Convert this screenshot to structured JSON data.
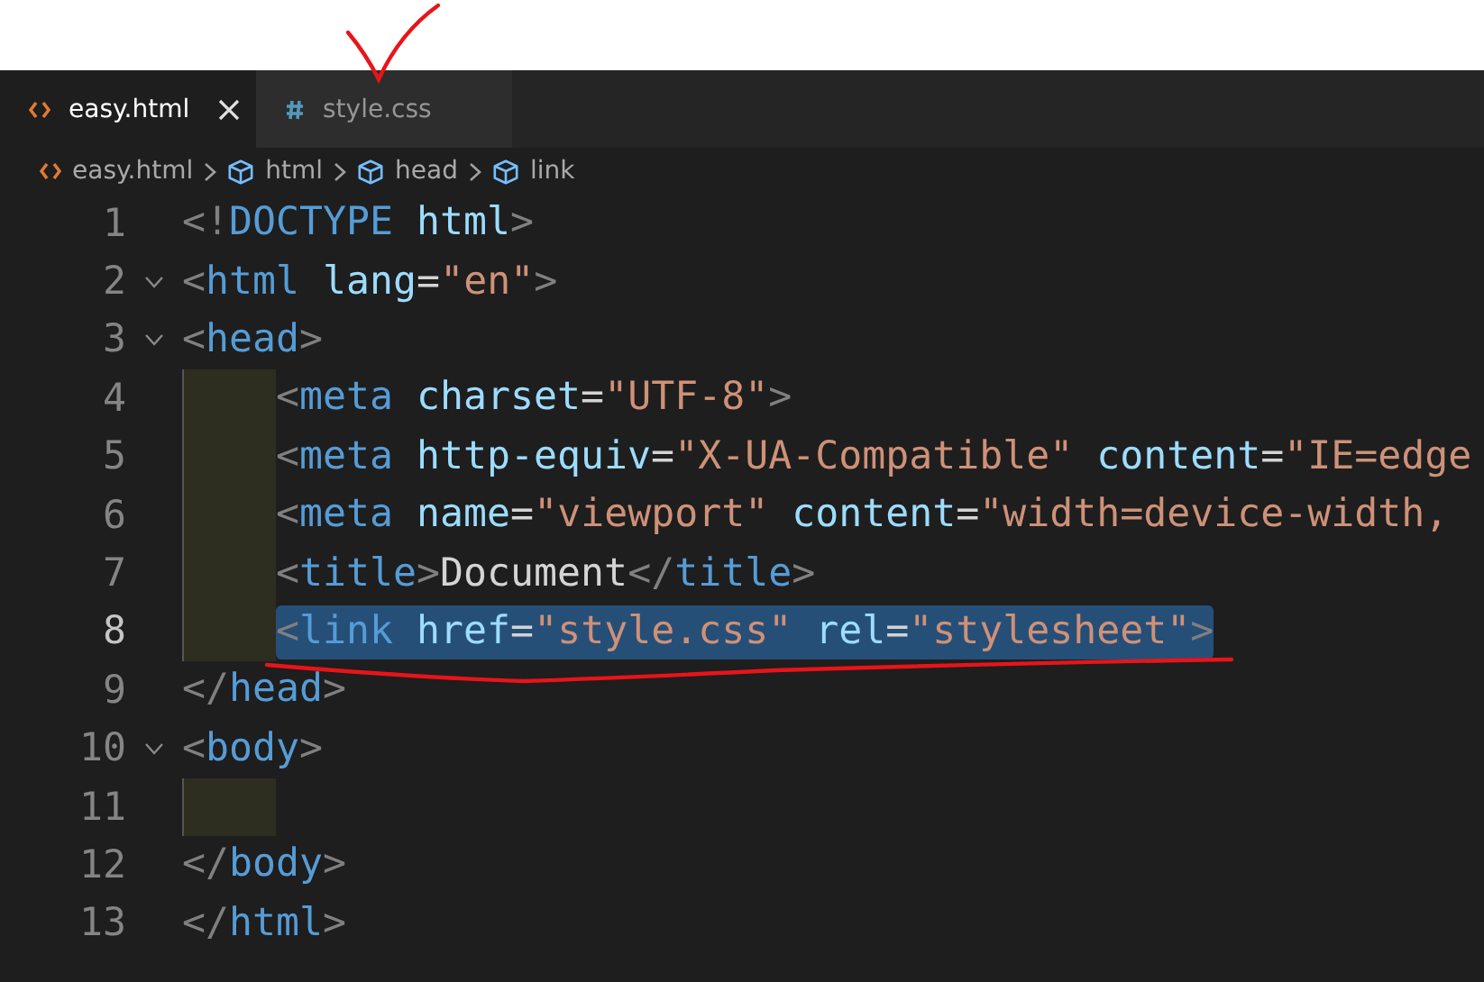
{
  "tabs": [
    {
      "label": "easy.html",
      "kind": "html",
      "selected": true
    },
    {
      "label": "style.css",
      "kind": "css",
      "selected": false
    }
  ],
  "breadcrumbs": [
    {
      "label": "easy.html",
      "kind": "file"
    },
    {
      "label": "html",
      "kind": "element"
    },
    {
      "label": "head",
      "kind": "element"
    },
    {
      "label": "link",
      "kind": "element"
    }
  ],
  "lines": [
    {
      "number": "1",
      "fold": false,
      "indented": false,
      "selected": false,
      "tokens": [
        {
          "kind": "punct",
          "text": "<!"
        },
        {
          "kind": "tag",
          "text": "DOCTYPE"
        },
        {
          "kind": "attr",
          "text": " html"
        },
        {
          "kind": "punct",
          "text": ">"
        }
      ]
    },
    {
      "number": "2",
      "fold": true,
      "indented": false,
      "selected": false,
      "tokens": [
        {
          "kind": "punct",
          "text": "<"
        },
        {
          "kind": "tag",
          "text": "html"
        },
        {
          "kind": "attr",
          "text": " lang"
        },
        {
          "kind": "text",
          "text": "="
        },
        {
          "kind": "str",
          "text": "\"en\""
        },
        {
          "kind": "punct",
          "text": ">"
        }
      ]
    },
    {
      "number": "3",
      "fold": true,
      "indented": false,
      "selected": false,
      "tokens": [
        {
          "kind": "punct",
          "text": "<"
        },
        {
          "kind": "tag",
          "text": "head"
        },
        {
          "kind": "punct",
          "text": ">"
        }
      ]
    },
    {
      "number": "4",
      "fold": false,
      "indented": true,
      "selected": false,
      "tokens": [
        {
          "kind": "punct",
          "text": "<"
        },
        {
          "kind": "tag",
          "text": "meta"
        },
        {
          "kind": "attr",
          "text": " charset"
        },
        {
          "kind": "text",
          "text": "="
        },
        {
          "kind": "str",
          "text": "\"UTF-8\""
        },
        {
          "kind": "punct",
          "text": ">"
        }
      ]
    },
    {
      "number": "5",
      "fold": false,
      "indented": true,
      "selected": false,
      "tokens": [
        {
          "kind": "punct",
          "text": "<"
        },
        {
          "kind": "tag",
          "text": "meta"
        },
        {
          "kind": "attr",
          "text": " http-equiv"
        },
        {
          "kind": "text",
          "text": "="
        },
        {
          "kind": "str",
          "text": "\"X-UA-Compatible\""
        },
        {
          "kind": "attr",
          "text": " content"
        },
        {
          "kind": "text",
          "text": "="
        },
        {
          "kind": "str",
          "text": "\"IE=edge"
        }
      ]
    },
    {
      "number": "6",
      "fold": false,
      "indented": true,
      "selected": false,
      "tokens": [
        {
          "kind": "punct",
          "text": "<"
        },
        {
          "kind": "tag",
          "text": "meta"
        },
        {
          "kind": "attr",
          "text": " name"
        },
        {
          "kind": "text",
          "text": "="
        },
        {
          "kind": "str",
          "text": "\"viewport\""
        },
        {
          "kind": "attr",
          "text": " content"
        },
        {
          "kind": "text",
          "text": "="
        },
        {
          "kind": "str",
          "text": "\"width=device-width,"
        }
      ]
    },
    {
      "number": "7",
      "fold": false,
      "indented": true,
      "selected": false,
      "tokens": [
        {
          "kind": "punct",
          "text": "<"
        },
        {
          "kind": "tag",
          "text": "title"
        },
        {
          "kind": "punct",
          "text": ">"
        },
        {
          "kind": "text",
          "text": "Document"
        },
        {
          "kind": "punct",
          "text": "</"
        },
        {
          "kind": "tag",
          "text": "title"
        },
        {
          "kind": "punct",
          "text": ">"
        }
      ]
    },
    {
      "number": "8",
      "fold": false,
      "indented": true,
      "selected": true,
      "tokens": [
        {
          "kind": "punct",
          "text": "<"
        },
        {
          "kind": "tag",
          "text": "link"
        },
        {
          "kind": "attr",
          "text": " href"
        },
        {
          "kind": "text",
          "text": "="
        },
        {
          "kind": "str",
          "text": "\"style.css\""
        },
        {
          "kind": "attr",
          "text": " rel"
        },
        {
          "kind": "text",
          "text": "="
        },
        {
          "kind": "str",
          "text": "\"stylesheet\""
        },
        {
          "kind": "punct",
          "text": ">"
        }
      ]
    },
    {
      "number": "9",
      "fold": false,
      "indented": false,
      "selected": false,
      "tokens": [
        {
          "kind": "punct",
          "text": "</"
        },
        {
          "kind": "tag",
          "text": "head"
        },
        {
          "kind": "punct",
          "text": ">"
        }
      ]
    },
    {
      "number": "10",
      "fold": true,
      "indented": false,
      "selected": false,
      "tokens": [
        {
          "kind": "punct",
          "text": "<"
        },
        {
          "kind": "tag",
          "text": "body"
        },
        {
          "kind": "punct",
          "text": ">"
        }
      ]
    },
    {
      "number": "11",
      "fold": false,
      "indented": true,
      "selected": false
    },
    {
      "number": "12",
      "fold": false,
      "indented": false,
      "selected": false,
      "tokens": [
        {
          "kind": "punct",
          "text": "</"
        },
        {
          "kind": "tag",
          "text": "body"
        },
        {
          "kind": "punct",
          "text": ">"
        }
      ]
    },
    {
      "number": "13",
      "fold": false,
      "indented": false,
      "selected": false,
      "tokens": [
        {
          "kind": "punct",
          "text": "</"
        },
        {
          "kind": "tag",
          "text": "html"
        },
        {
          "kind": "punct",
          "text": ">"
        }
      ]
    }
  ]
}
